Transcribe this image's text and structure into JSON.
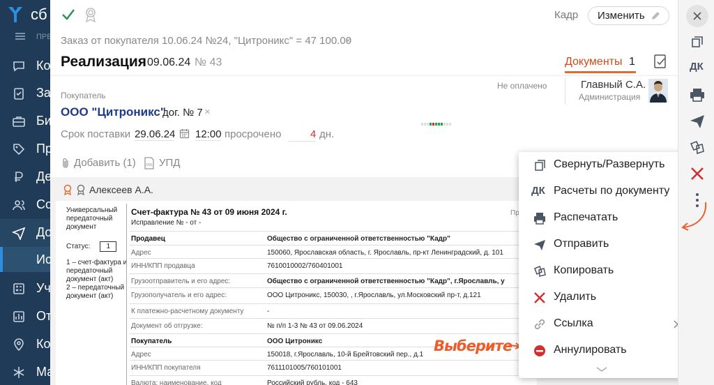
{
  "nav": {
    "brand": "сб",
    "section_label": "ПРЕ",
    "items": [
      {
        "label": "Ко",
        "icon": "chat-icon"
      },
      {
        "label": "За",
        "icon": "tasks-icon"
      },
      {
        "label": "Би",
        "icon": "briefcase-icon"
      },
      {
        "label": "Пр",
        "icon": "tag-icon"
      },
      {
        "label": "Де",
        "icon": "ruble-icon"
      },
      {
        "label": "Со",
        "icon": "people-icon"
      },
      {
        "label": "До",
        "icon": "send-icon"
      },
      {
        "label": "Уч",
        "icon": "calculator-icon"
      },
      {
        "label": "От",
        "icon": "chart-icon"
      },
      {
        "label": "Ко",
        "icon": "location-icon"
      },
      {
        "label": "Ма",
        "icon": "asterisk-icon"
      }
    ],
    "sub_item": "Ис"
  },
  "header": {
    "kadr": "Кадр",
    "edit_label": "Изменить",
    "order_link": "Заказ от покупателя 10.06.24 №24, \"Цитроникс\" = 47 100.00",
    "title": "Реализация",
    "date": "09.06.24",
    "number": "№ 43",
    "tab_docs": "Документы",
    "tab_docs_count": "1"
  },
  "buyer": {
    "label": "Покупатель",
    "name": "ООО \"Цитроникс\"",
    "contract": "дог. № 7",
    "payment_status": "Не оплачено"
  },
  "responsible": {
    "name": "Главный С.А.",
    "role": "Администрация"
  },
  "delivery": {
    "label": "Срок поставки",
    "date": "29.06.24",
    "time": "12:00",
    "overdue_label": "просрочено",
    "overdue_days": "4",
    "overdue_unit": "дн."
  },
  "attachments": {
    "add_label": "Добавить (1)",
    "upd_label": "УПД"
  },
  "signer": "Алексеев А.А.",
  "preview": {
    "left_title": "Универсальный передаточный документ",
    "status_label": "Статус:",
    "status_value": "1",
    "status_options": "1 – счет-фактура и передаточный документ (акт)\n2 – передаточный документ (акт)",
    "title": "Счет-фактура № 43 от 09 июня 2024 г.",
    "correction": "Исправление № - от -",
    "right_note": "При",
    "rows": [
      {
        "k": "Продавец",
        "v": "Общество с ограниченной ответственностью \"Кадр\"",
        "kb": true,
        "vb": true
      },
      {
        "k": "Адрес",
        "v": "150060, Ярославская область, г. Ярославль, пр-кт Ленинградский, д. 101",
        "kb": false,
        "vb": false
      },
      {
        "k": "ИНН/КПП продавца",
        "v": "7610010002/760401001",
        "kb": false,
        "vb": false
      },
      {
        "k": "Грузоотправитель и его адрес:",
        "v": "Общество с ограниченной ответственностью \"Кадр\", г.Ярославль, у",
        "kb": false,
        "vb": true
      },
      {
        "k": "Грузополучатель и его адрес:",
        "v": "ООО Цитроникс, 150030, , г.Ярославль, ул.Московский пр-т, д.121",
        "kb": false,
        "vb": false
      },
      {
        "k": "К платежно-расчетному документу",
        "v": "-",
        "kb": false,
        "vb": false
      },
      {
        "k": "Документ об отгрузке:",
        "v": "№ п/п 1-3 № 43 от 09.06.2024",
        "kb": false,
        "vb": false
      },
      {
        "k": "Покупатель",
        "v": "ООО Цитроникс",
        "kb": true,
        "vb": true
      },
      {
        "k": "Адрес",
        "v": "150018, г.Ярославль, 10-й Брейтовский пер., д.1",
        "kb": false,
        "vb": false
      },
      {
        "k": "ИНН/КПП покупателя",
        "v": "7611101005/760101001",
        "kb": false,
        "vb": false
      },
      {
        "k": "Валюта: наименование, код",
        "v": "Российский рубль, код - 643",
        "kb": false,
        "vb": false
      }
    ]
  },
  "menu": {
    "items": [
      {
        "label": "Свернуть/Развернуть",
        "icon": "collapse-icon"
      },
      {
        "label": "Расчеты по документу",
        "icon": "dk-icon",
        "icon_text": "ДК"
      },
      {
        "label": "Распечатать",
        "icon": "printer-icon"
      },
      {
        "label": "Отправить",
        "icon": "send-icon"
      },
      {
        "label": "Копировать",
        "icon": "copy-icon"
      },
      {
        "label": "Удалить",
        "icon": "delete-icon"
      },
      {
        "label": "Ссылка",
        "icon": "link-icon"
      },
      {
        "label": "Аннулировать",
        "icon": "annul-icon"
      }
    ]
  },
  "annotation": "Выберите",
  "rbar": {
    "dk": "ДК"
  },
  "colors": {
    "nav_bg": "#1f3b57",
    "accent_orange": "#e46a2e",
    "link_blue": "#1e3a8a",
    "danger_red": "#d32f2f",
    "check_green": "#2e8b57"
  }
}
